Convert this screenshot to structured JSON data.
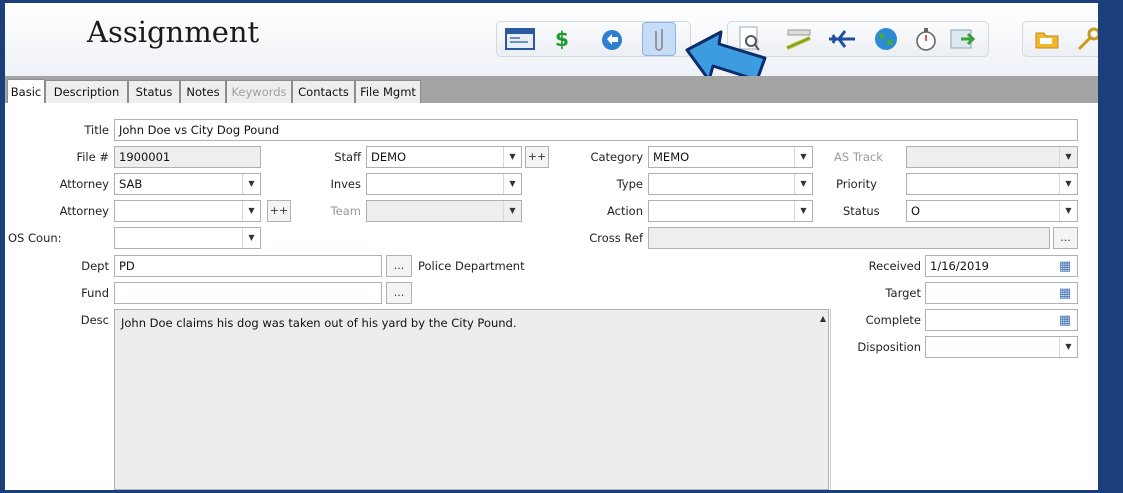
{
  "window": {
    "title": "Assignment"
  },
  "toolbar": {
    "icons": [
      "card-icon",
      "dollar-icon",
      "undo-icon",
      "paperclip-icon",
      "search-doc-icon",
      "ruler-pencil-icon",
      "plane-icon",
      "globe-icon",
      "stopwatch-icon",
      "export-icon",
      "folder-icon",
      "key-icon"
    ]
  },
  "tabs": [
    {
      "label": "Basic",
      "selected": true
    },
    {
      "label": "Description"
    },
    {
      "label": "Status"
    },
    {
      "label": "Notes"
    },
    {
      "label": "Keywords",
      "disabled": true
    },
    {
      "label": "Contacts"
    },
    {
      "label": "File Mgmt"
    }
  ],
  "form": {
    "title_label": "Title",
    "title_value": "John Doe vs City Dog Pound",
    "file_label": "File #",
    "file_value": "1900001",
    "staff_label": "Staff",
    "staff_value": "DEMO",
    "plusplus": "++",
    "category_label": "Category",
    "category_value": "MEMO",
    "astrack_label": "AS Track",
    "astrack_value": "",
    "attorney1_label": "Attorney",
    "attorney1_value": "SAB",
    "inves_label": "Inves",
    "inves_value": "",
    "type_label": "Type",
    "type_value": "",
    "priority_label": "Priority",
    "priority_value": "",
    "attorney2_label": "Attorney",
    "attorney2_value": "",
    "team_label": "Team",
    "team_value": "",
    "action_label": "Action",
    "action_value": "",
    "status_label": "Status",
    "status_value": "O",
    "oscoun_label": "OS Coun:",
    "oscoun_value": "",
    "crossref_label": "Cross Ref",
    "crossref_value": "",
    "ellipsis": "...",
    "dept_label": "Dept",
    "dept_value": "PD",
    "dept_desc": "Police Department",
    "received_label": "Received",
    "received_value": "1/16/2019",
    "fund_label": "Fund",
    "fund_value": "",
    "target_label": "Target",
    "target_value": "",
    "desc_label": "Desc",
    "desc_value": "John Doe claims his dog was taken out of his yard by the City Pound.",
    "complete_label": "Complete",
    "complete_value": "",
    "disposition_label": "Disposition",
    "disposition_value": ""
  },
  "colors": {
    "frame": "#1a3f7a",
    "tabbar": "#a4a4a4",
    "arrow": "#3d9be0",
    "readonly": "#eeeeee"
  }
}
